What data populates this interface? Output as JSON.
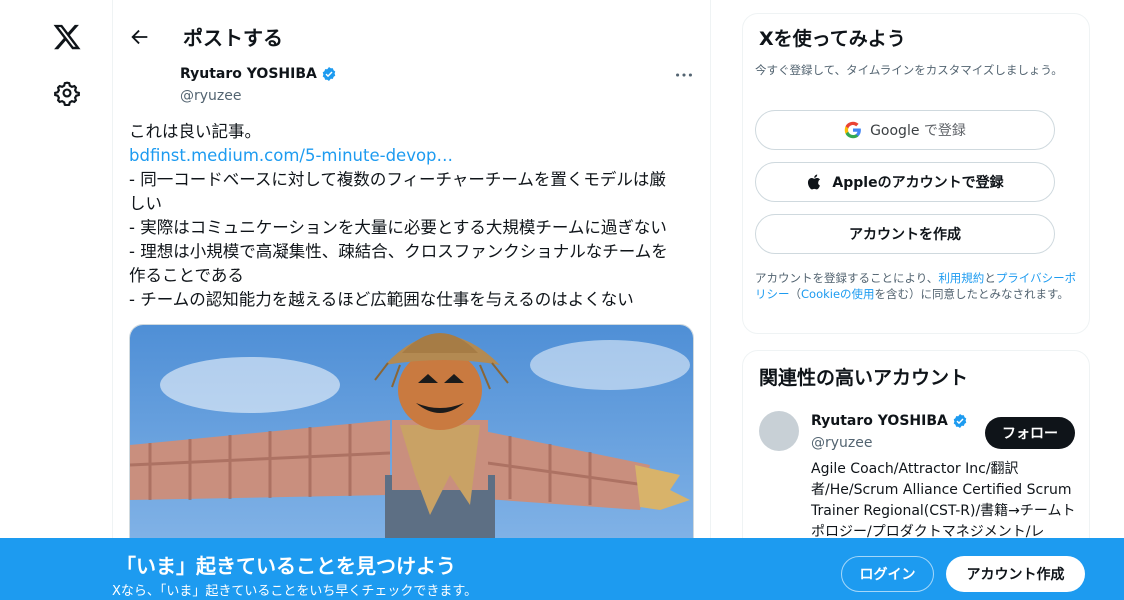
{
  "header": {
    "title": "ポストする"
  },
  "author": {
    "name": "Ryutaro YOSHIBA",
    "handle": "@ryuzee"
  },
  "post": {
    "lines": [
      "これは良い記事。",
      "bdfinst.medium.com/5-minute-devop…",
      "- 同一コードベースに対して複数のフィーチャーチームを置くモデルは厳",
      "しい",
      "- 実際はコミュニケーションを大量に必要とする大規模チームに過ぎない",
      "- 理想は小規模で高凝集性、疎結合、クロスファンクショナルなチームを",
      "作ることである",
      "- チームの認知能力を越えるほど広範囲な仕事を与えるのはよくない"
    ]
  },
  "signup_card": {
    "title": "Xを使ってみよう",
    "subtitle": "今すぐ登録して、タイムラインをカスタマイズしましょう。",
    "google_label_main": "Google",
    "google_label_suffix": "で登録",
    "apple_label": "Appleのアカウントで登録",
    "create_label": "アカウントを作成",
    "terms_prefix": "アカウントを登録することにより、",
    "terms_link": "利用規約",
    "terms_and": "と",
    "privacy_link": "プライバシーポリシー",
    "paren_open": "（",
    "cookie_link": "Cookieの使用",
    "terms_suffix": "を含む）に同意したとみなされます。"
  },
  "related": {
    "title": "関連性の高いアカウント",
    "account": {
      "name": "Ryutaro YOSHIBA",
      "handle": "@ryuzee",
      "follow_label": "フォロー",
      "bio": "Agile Coach/Attractor Inc/翻訳者/He/Scrum Alliance Certified Scrum Trainer Regional(CST-R)/書籍→チームトポロジー/プロダクトマネジメント/レ"
    }
  },
  "banner": {
    "title": "「いま」起きていることを見つけよう",
    "subtitle": "Xなら、「いま」起きていることをいち早くチェックできます。",
    "login_label": "ログイン",
    "signup_label": "アカウント作成"
  },
  "colors": {
    "accent": "#1d9bf0",
    "text": "#0f1419",
    "muted": "#536471"
  }
}
